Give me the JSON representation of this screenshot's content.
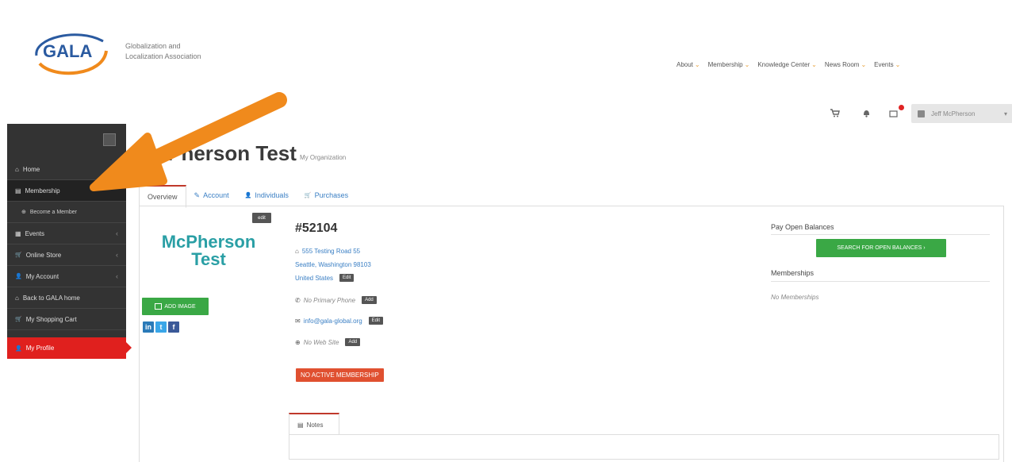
{
  "header": {
    "logo_text": "GALA",
    "tagline_line1": "Globalization and",
    "tagline_line2": "Localization Association",
    "nav": [
      {
        "label": "About"
      },
      {
        "label": "Membership"
      },
      {
        "label": "Knowledge Center"
      },
      {
        "label": "News Room"
      },
      {
        "label": "Events"
      }
    ],
    "caret": "⌄",
    "user_name": "Jeff McPherson",
    "user_caret": "▾"
  },
  "sidebar": {
    "items": [
      {
        "label": "Home",
        "icon": "⌂"
      },
      {
        "label": "Membership",
        "icon": "▤"
      },
      {
        "label": "Become a Member",
        "icon": "⊕"
      },
      {
        "label": "Events",
        "icon": "▦",
        "chevron": "‹"
      },
      {
        "label": "Online Store",
        "icon": "🛒",
        "chevron": "‹"
      },
      {
        "label": "My Account",
        "icon": "👤",
        "chevron": "‹"
      },
      {
        "label": "Back to GALA home",
        "icon": "⌂"
      },
      {
        "label": "My Shopping Cart",
        "icon": "🛒"
      },
      {
        "label": "My Profile",
        "icon": "👤"
      }
    ]
  },
  "page": {
    "title": "McPherson Test",
    "subtitle": "My Organization"
  },
  "tabs": [
    {
      "label": "Overview",
      "icon": ""
    },
    {
      "label": "Account",
      "icon": "✎"
    },
    {
      "label": "Individuals",
      "icon": "👤"
    },
    {
      "label": "Purchases",
      "icon": "🛒"
    }
  ],
  "org": {
    "logo_line1": "McPherson",
    "logo_line2": "Test",
    "logo_edit": "edit",
    "add_image": "ADD IMAGE",
    "number": "#52104",
    "address_line1": "555 Testing Road 55",
    "address_line2": "Seattle, Washington 98103",
    "address_line3": "United States",
    "edit_label": "Edit",
    "add_label": "Add",
    "phone": "No Primary Phone",
    "email": "info@gala-global.org",
    "website": "No Web Site",
    "membership_status": "NO ACTIVE MEMBERSHIP",
    "social": [
      "in",
      "t",
      "f"
    ]
  },
  "right": {
    "pay_heading": "Pay Open Balances",
    "search_button": "SEARCH FOR OPEN BALANCES ›",
    "memberships_heading": "Memberships",
    "no_memberships": "No Memberships"
  },
  "notes": {
    "tab_label": "Notes",
    "icon": "▤"
  },
  "colors": {
    "brand_orange": "#f08a1c",
    "brand_blue": "#2a5aa0",
    "sidebar_bg": "#333333",
    "active_red": "#e0201e",
    "green": "#3aa845",
    "link_blue": "#3a7fc4"
  }
}
